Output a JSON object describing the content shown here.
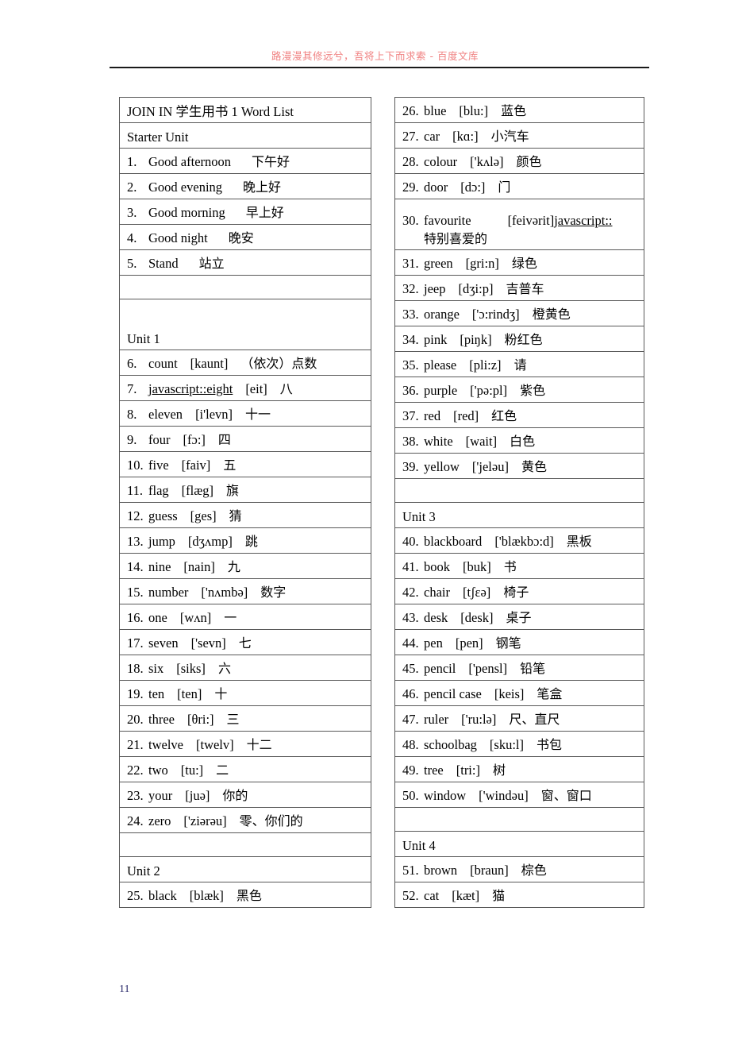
{
  "header": {
    "watermark": "路漫漫其修远兮，吾将上下而求索 - 百度文库",
    "watermark_color": "#f08080"
  },
  "footer": {
    "page_number": "11"
  },
  "left_table": {
    "rows": [
      {
        "type": "title",
        "text": "JOIN IN  学生用书 1 Word List"
      },
      {
        "type": "unit",
        "text": "Starter Unit"
      },
      {
        "type": "entry",
        "num": "1.",
        "word": "Good afternoon",
        "ipa": "",
        "cn": "下午好"
      },
      {
        "type": "entry",
        "num": "2.",
        "word": "Good evening",
        "ipa": "",
        "cn": "晚上好"
      },
      {
        "type": "entry",
        "num": "3.",
        "word": "Good morning",
        "ipa": "",
        "cn": "早上好"
      },
      {
        "type": "entry",
        "num": "4.",
        "word": "Good night",
        "ipa": "",
        "cn": "晚安"
      },
      {
        "type": "entry",
        "num": "5.",
        "word": "Stand",
        "ipa": "",
        "cn": "站立"
      },
      {
        "type": "spacer"
      },
      {
        "type": "unit_tall",
        "text": "Unit 1"
      },
      {
        "type": "entry",
        "num": "6.",
        "word": "count",
        "ipa": "[kaunt]",
        "cn": "（依次）点数"
      },
      {
        "type": "entry",
        "num": "7.",
        "word": "javascript::eight",
        "word_artifact": true,
        "ipa": "[eit]",
        "cn": "八"
      },
      {
        "type": "entry",
        "num": "8.",
        "word": "eleven",
        "ipa": "[i'levn]",
        "cn": "十一"
      },
      {
        "type": "entry",
        "num": "9.",
        "word": "four",
        "ipa": "[fɔ:]",
        "cn": "四"
      },
      {
        "type": "entry",
        "num": "10.",
        "word": "five",
        "ipa": "[faiv]",
        "cn": "五"
      },
      {
        "type": "entry",
        "num": "11.",
        "word": "flag",
        "ipa": "[flæg]",
        "cn": "旗"
      },
      {
        "type": "entry",
        "num": "12.",
        "word": "guess",
        "ipa": "[ges]",
        "cn": "猜"
      },
      {
        "type": "entry",
        "num": "13.",
        "word": "jump",
        "ipa": "[dʒʌmp]",
        "cn": "跳"
      },
      {
        "type": "entry",
        "num": "14.",
        "word": "nine",
        "ipa": "[nain]",
        "cn": "九"
      },
      {
        "type": "entry",
        "num": "15.",
        "word": "number",
        "ipa": "['nʌmbə]",
        "cn": "数字"
      },
      {
        "type": "entry",
        "num": "16.",
        "word": "one",
        "ipa": "[wʌn]",
        "cn": "一"
      },
      {
        "type": "entry",
        "num": "17.",
        "word": "seven",
        "ipa": "['sevn]",
        "cn": "七"
      },
      {
        "type": "entry",
        "num": "18.",
        "word": "six",
        "ipa": "[siks]",
        "cn": "六"
      },
      {
        "type": "entry",
        "num": "19.",
        "word": "ten",
        "ipa": "[ten]",
        "cn": "十"
      },
      {
        "type": "entry",
        "num": "20.",
        "word": "three",
        "ipa": "[θri:]",
        "cn": "三"
      },
      {
        "type": "entry",
        "num": "21.",
        "word": "twelve",
        "ipa": "[twelv]",
        "cn": "十二"
      },
      {
        "type": "entry",
        "num": "22.",
        "word": "two",
        "ipa": "[tu:]",
        "cn": "二"
      },
      {
        "type": "entry",
        "num": "23.",
        "word": "your",
        "ipa": "[juə]",
        "cn": "你的"
      },
      {
        "type": "entry",
        "num": "24.",
        "word": "zero",
        "ipa": "['ziərəu]",
        "cn": "零、你们的"
      },
      {
        "type": "spacer"
      },
      {
        "type": "unit",
        "text": "Unit 2"
      },
      {
        "type": "entry",
        "num": "25.",
        "word": "black",
        "ipa": "[blæk]",
        "cn": "黑色"
      }
    ]
  },
  "right_table": {
    "rows": [
      {
        "type": "entry",
        "num": "26.",
        "word": "blue",
        "ipa": "[blu:]",
        "cn": "蓝色"
      },
      {
        "type": "entry",
        "num": "27.",
        "word": "car",
        "ipa": "[kɑ:]",
        "cn": "小汽车"
      },
      {
        "type": "entry",
        "num": "28.",
        "word": "colour",
        "ipa": "['kʌlə]",
        "cn": "颜色"
      },
      {
        "type": "entry",
        "num": "29.",
        "word": "door",
        "ipa": "[dɔ:]",
        "cn": "门"
      },
      {
        "type": "entry_wrap",
        "num": "30.",
        "word": "favourite",
        "ipa": "[feivərit]",
        "trailing_artifact": "javascript::",
        "cn": "特别喜爱的"
      },
      {
        "type": "entry",
        "num": "31.",
        "word": "green",
        "ipa": "[gri:n]",
        "cn": "绿色"
      },
      {
        "type": "entry",
        "num": "32.",
        "word": "jeep",
        "ipa": "[dʒi:p]",
        "cn": "吉普车"
      },
      {
        "type": "entry",
        "num": "33.",
        "word": "orange",
        "ipa": "['ɔ:rindʒ]",
        "cn": "橙黄色"
      },
      {
        "type": "entry",
        "num": "34.",
        "word": "pink",
        "ipa": "[piŋk]",
        "cn": "粉红色"
      },
      {
        "type": "entry",
        "num": "35.",
        "word": "please",
        "ipa": "[pli:z]",
        "cn": "请"
      },
      {
        "type": "entry",
        "num": "36.",
        "word": "purple",
        "ipa": "['pə:pl]",
        "cn": "紫色"
      },
      {
        "type": "entry",
        "num": "37.",
        "word": "red",
        "ipa": "[red]",
        "cn": "红色"
      },
      {
        "type": "entry",
        "num": "38.",
        "word": "white",
        "ipa": "[wait]",
        "cn": "白色"
      },
      {
        "type": "entry",
        "num": "39.",
        "word": "yellow",
        "ipa": "['jeləu]",
        "cn": "黄色"
      },
      {
        "type": "spacer"
      },
      {
        "type": "unit",
        "text": "Unit 3"
      },
      {
        "type": "entry",
        "num": "40.",
        "word": "blackboard",
        "ipa": "['blækbɔ:d]",
        "cn": "黑板"
      },
      {
        "type": "entry",
        "num": "41.",
        "word": "book",
        "ipa": "[buk]",
        "cn": "书"
      },
      {
        "type": "entry",
        "num": "42.",
        "word": "chair",
        "ipa": "[tʃɛə]",
        "cn": "椅子"
      },
      {
        "type": "entry",
        "num": "43.",
        "word": "desk",
        "ipa": "[desk]",
        "cn": "桌子"
      },
      {
        "type": "entry",
        "num": "44.",
        "word": "pen",
        "ipa": "[pen]",
        "cn": "钢笔"
      },
      {
        "type": "entry",
        "num": "45.",
        "word": "pencil",
        "ipa": "['pensl]",
        "cn": "铅笔"
      },
      {
        "type": "entry",
        "num": "46.",
        "word": "pencil case",
        "ipa": "[keis]",
        "cn": "笔盒"
      },
      {
        "type": "entry",
        "num": "47.",
        "word": "ruler",
        "ipa": "['ru:lə]",
        "cn": "尺、直尺"
      },
      {
        "type": "entry",
        "num": "48.",
        "word": "schoolbag",
        "ipa": "[sku:l]",
        "cn": "书包"
      },
      {
        "type": "entry",
        "num": "49.",
        "word": "tree",
        "ipa": "[tri:]",
        "cn": "树"
      },
      {
        "type": "entry",
        "num": "50.",
        "word": "window",
        "ipa": "['windəu]",
        "cn": "窗、窗口"
      },
      {
        "type": "spacer"
      },
      {
        "type": "unit",
        "text": "Unit 4"
      },
      {
        "type": "entry",
        "num": "51.",
        "word": "brown",
        "ipa": "[braun]",
        "cn": "棕色"
      },
      {
        "type": "entry",
        "num": "52.",
        "word": "cat",
        "ipa": "[kæt]",
        "cn": "猫"
      }
    ]
  }
}
